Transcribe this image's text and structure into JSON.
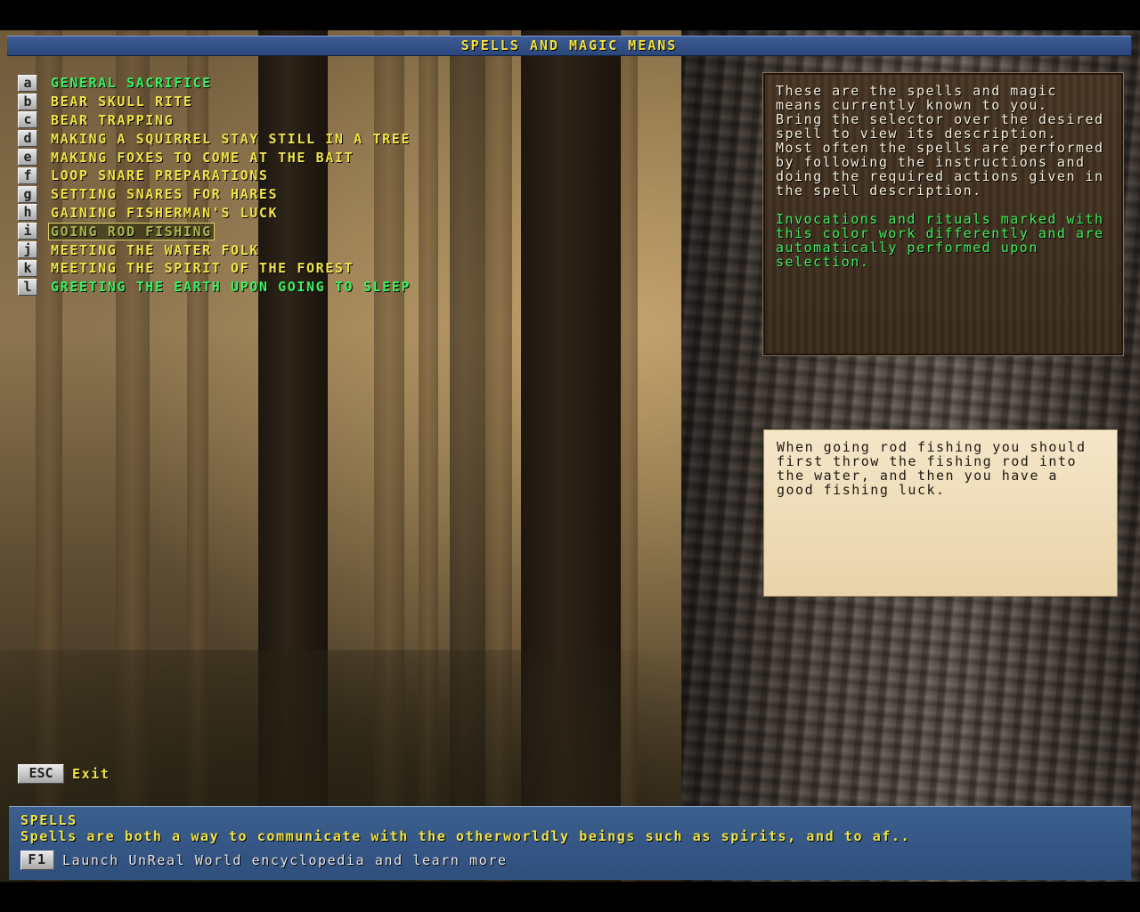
{
  "window": {
    "title": "SPELLS AND MAGIC MEANS"
  },
  "spells": [
    {
      "key": "a",
      "label": "GENERAL SACRIFICE",
      "color": "green"
    },
    {
      "key": "b",
      "label": "BEAR SKULL RITE",
      "color": "yellow"
    },
    {
      "key": "c",
      "label": "BEAR TRAPPING",
      "color": "yellow"
    },
    {
      "key": "d",
      "label": "MAKING A SQUIRREL STAY STILL IN A TREE",
      "color": "yellow"
    },
    {
      "key": "e",
      "label": "MAKING FOXES TO COME AT THE BAIT",
      "color": "yellow"
    },
    {
      "key": "f",
      "label": "LOOP SNARE PREPARATIONS",
      "color": "yellow"
    },
    {
      "key": "g",
      "label": "SETTING SNARES FOR HARES",
      "color": "yellow"
    },
    {
      "key": "h",
      "label": "GAINING FISHERMAN'S LUCK",
      "color": "yellow"
    },
    {
      "key": "i",
      "label": "GOING ROD FISHING",
      "color": "yellow",
      "selected": true
    },
    {
      "key": "j",
      "label": "MEETING THE WATER FOLK",
      "color": "yellow"
    },
    {
      "key": "k",
      "label": "MEETING THE SPIRIT OF THE FOREST",
      "color": "yellow"
    },
    {
      "key": "l",
      "label": "GREETING THE EARTH UPON GOING TO SLEEP",
      "color": "green"
    }
  ],
  "info_panel": {
    "intro": "These are the spells and magic means currently known to you.",
    "selector": "Bring the selector over the desired spell to view its description.",
    "usage": "Most often the spells are performed by following the instructions and doing the required actions given in the spell description.",
    "invocations_note": "Invocations and rituals marked with this color work differently and are automatically performed upon selection."
  },
  "description_panel": {
    "text": "When going rod fishing you should first throw the fishing rod into the water, and then you have a good fishing luck."
  },
  "exit": {
    "key": "ESC",
    "label": "Exit"
  },
  "footer": {
    "title": "SPELLS",
    "text": "Spells are both a way to communicate with the otherworldly beings such as spirits, and to af..",
    "f1_key": "F1",
    "f1_label": "Launch UnReal World encyclopedia and learn more"
  },
  "colors": {
    "title_bar": "#2b4578",
    "normal_spell": "#f0e446",
    "special_spell": "#3cf060",
    "footer": "#2f4f7d"
  }
}
